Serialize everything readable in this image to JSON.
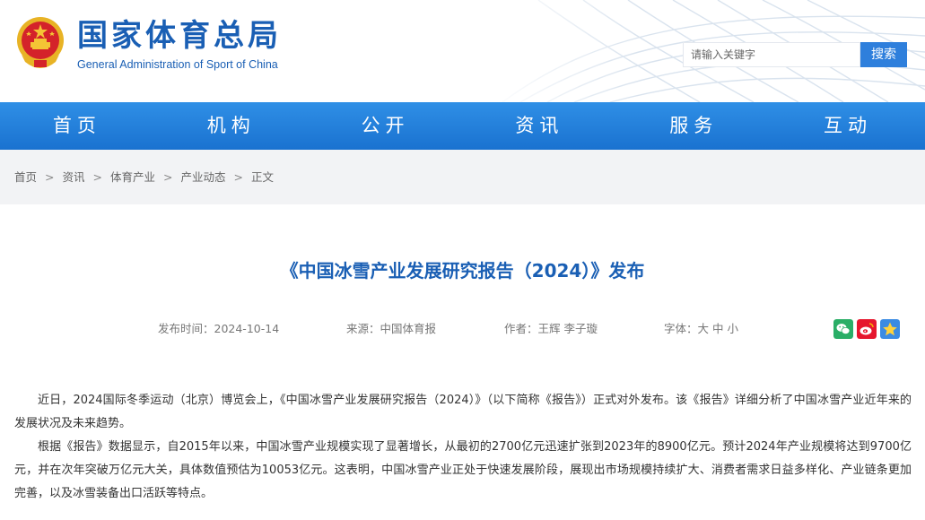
{
  "header": {
    "site_name": "国家体育总局",
    "site_name_en": "General Administration of Sport of China",
    "search_placeholder": "请输入关键字",
    "search_button": "搜索"
  },
  "nav": [
    "首页",
    "机构",
    "公开",
    "资讯",
    "服务",
    "互动"
  ],
  "breadcrumb": [
    "首页",
    "资讯",
    "体育产业",
    "产业动态",
    "正文"
  ],
  "breadcrumb_separator": ">",
  "article": {
    "title": "《中国冰雪产业发展研究报告（2024）》发布",
    "publish_time": "发布时间：2024-10-14",
    "source": "来源：中国体育报",
    "author": "作者：王辉 李子璇",
    "font_size_label": "字体：",
    "font_sizes": [
      "大",
      "中",
      "小"
    ],
    "paragraphs": [
      "近日，2024国际冬季运动（北京）博览会上，《中国冰雪产业发展研究报告（2024）》（以下简称《报告》）正式对外发布。该《报告》详细分析了中国冰雪产业近年来的发展状况及未来趋势。",
      "根据《报告》数据显示，自2015年以来，中国冰雪产业规模实现了显著增长，从最初的2700亿元迅速扩张到2023年的8900亿元。预计2024年产业规模将达到9700亿元，并在次年突破万亿元大关，具体数值预估为10053亿元。这表明，中国冰雪产业正处于快速发展阶段，展现出市场规模持续扩大、消费者需求日益多样化、产业链条更加完善，以及冰雪装备出口活跃等特点。"
    ]
  },
  "share_icons": [
    "wechat-icon",
    "weibo-icon",
    "qzone-icon"
  ],
  "colors": {
    "brand_blue": "#1a5fb4",
    "nav_blue": "#1a72d0",
    "wechat_green": "#2aae67",
    "weibo_red": "#e6162d",
    "qzone_blue": "#3a8be3"
  }
}
